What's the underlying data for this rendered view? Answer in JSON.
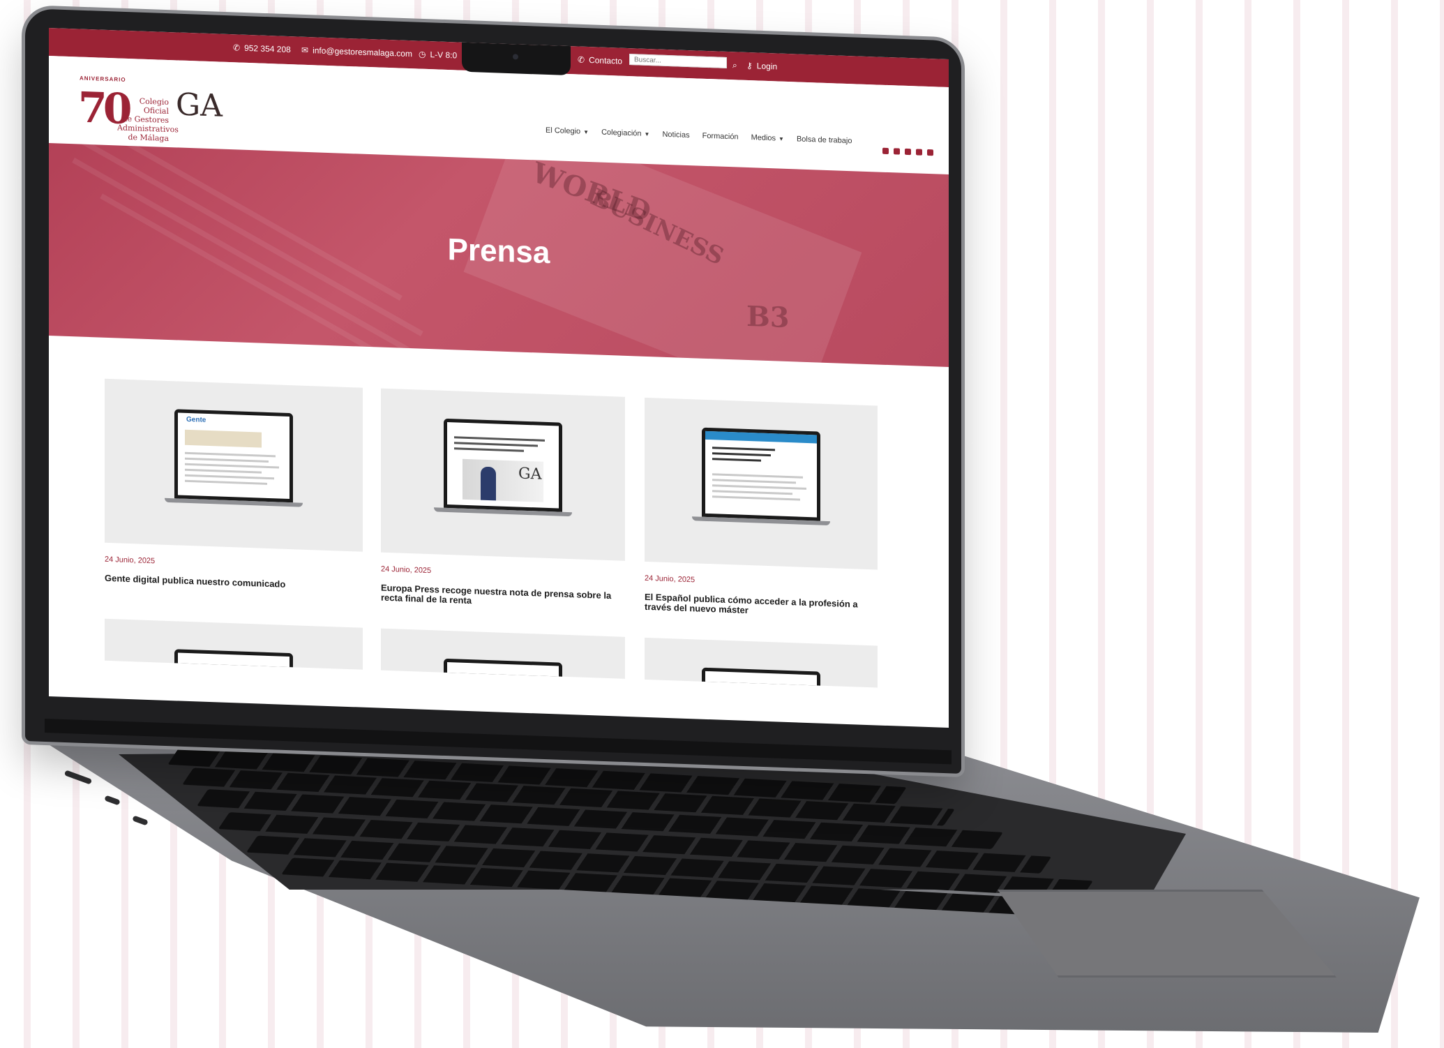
{
  "topbar": {
    "phone": "952 354 208",
    "email": "info@gestoresmalaga.com",
    "hours": "L-V 8:0",
    "contact": "Contacto",
    "search_placeholder": "Buscar...",
    "login": "Login"
  },
  "logo": {
    "badge": "ANIVERSARIO",
    "number": "70",
    "line1": "Colegio Oficial",
    "line2": "de Gestores",
    "line3": "Administrativos",
    "line4": "de Málaga",
    "mark": "GA"
  },
  "nav": [
    {
      "label": "El Colegio",
      "dropdown": true
    },
    {
      "label": "Colegiación",
      "dropdown": true
    },
    {
      "label": "Noticias",
      "dropdown": false
    },
    {
      "label": "Formación",
      "dropdown": false
    },
    {
      "label": "Medios",
      "dropdown": true
    },
    {
      "label": "Bolsa de trabajo",
      "dropdown": false
    }
  ],
  "socials": [
    "facebook-icon",
    "linkedin-icon",
    "x-icon",
    "youtube-icon",
    "instagram-icon"
  ],
  "hero": {
    "title": "Prensa",
    "decor": {
      "world": "WORLD",
      "business": "BUSINESS",
      "b3": "B3"
    }
  },
  "cards": [
    {
      "date": "24 Junio, 2025",
      "title": "Gente digital publica nuestro comunicado",
      "thumb_brand": "Gente"
    },
    {
      "date": "24 Junio, 2025",
      "title": "Europa Press recoge nuestra nota de prensa sobre la recta final de la renta",
      "thumb_brand": ""
    },
    {
      "date": "24 Junio, 2025",
      "title": "El Español publica cómo acceder a la profesión a través del nuevo máster",
      "thumb_brand": ""
    }
  ],
  "colors": {
    "brand": "#9b2335",
    "hero": "#c4566a",
    "laptop": "#7d7e82"
  }
}
